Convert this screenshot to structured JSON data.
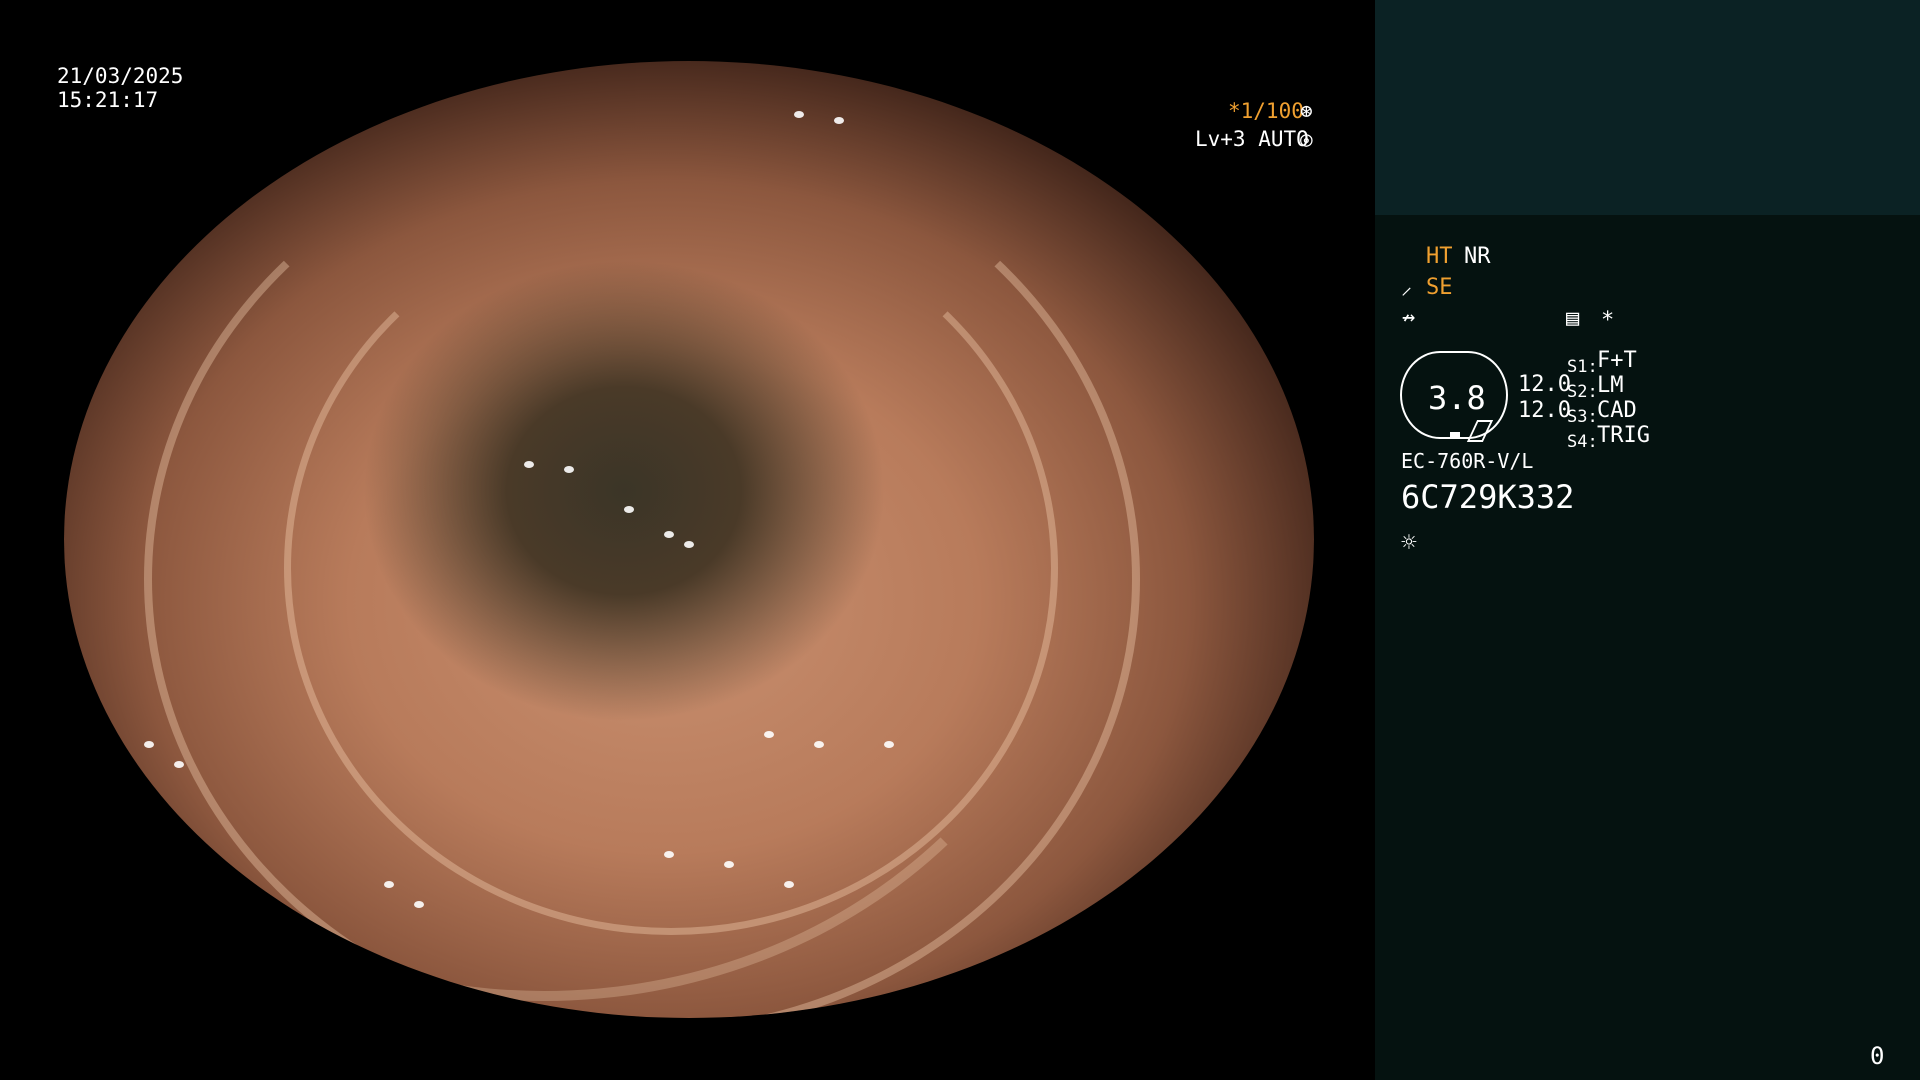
{
  "datetime": {
    "date": "21/03/2025",
    "time": "15:21:17"
  },
  "overlay": {
    "shutter": "*1/100",
    "level": "Lv+3 AUTO",
    "shutter_icon": "aperture-icon",
    "level_icon": "iris-icon"
  },
  "panel": {
    "ht": "HT",
    "nr": "NR",
    "se": "SE",
    "se_icon": "scope-icon",
    "flash_icon": "lightning-icon",
    "menu_icon": "settings-icon",
    "star": "*",
    "lens_value": "3.8",
    "values": [
      "12.0",
      "12.0"
    ],
    "switches": [
      {
        "key": "S1:",
        "value": "F+T"
      },
      {
        "key": "S2:",
        "value": "LM"
      },
      {
        "key": "S3:",
        "value": "CAD"
      },
      {
        "key": "S4:",
        "value": "TRIG"
      }
    ],
    "model": "EC-760R-V/L",
    "serial": "6C729K332",
    "light_icon": "sun-icon",
    "counter": "0"
  },
  "colors": {
    "accent": "#f0a030",
    "panel_top": "#0b2224",
    "panel_bottom": "#051210"
  }
}
